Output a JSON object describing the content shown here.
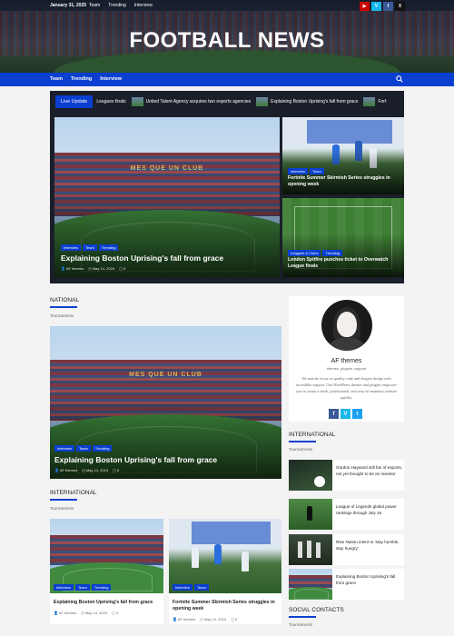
{
  "topbar": {
    "date": "January 31, 2025",
    "links": [
      "Team",
      "Trending",
      "Interview"
    ],
    "social": [
      {
        "name": "youtube-icon",
        "glyph": "▶",
        "color": "#cc0000"
      },
      {
        "name": "vimeo-icon",
        "glyph": "V",
        "color": "#1ab7ea"
      },
      {
        "name": "facebook-icon",
        "glyph": "f",
        "color": "#3b5998"
      },
      {
        "name": "x-icon",
        "glyph": "X",
        "color": "#111111"
      }
    ]
  },
  "site": {
    "title": "FOOTBALL NEWS"
  },
  "nav": {
    "items": [
      "Team",
      "Trending",
      "Interview"
    ]
  },
  "ticker": {
    "label": "Live Update",
    "items": [
      "Leagues finals",
      "United Talent Agency acquires two esports agencies",
      "Explaining Boston Uprising's fall from grace",
      "Fort"
    ]
  },
  "hero": {
    "main": {
      "tags": [
        "Interview",
        "Team",
        "Trending"
      ],
      "title": "Explaining Boston Uprising's fall from grace",
      "author": "AF themes",
      "date": "May 14, 2024",
      "comments": "0"
    },
    "side1": {
      "tags": [
        "Interview",
        "Team"
      ],
      "title": "Fortnite Summer Skirmish Series struggles in opening week"
    },
    "side2": {
      "tags": [
        "Leagues & Clubs",
        "Trending"
      ],
      "title": "London Spitfire punches ticket to Overwatch League finals"
    }
  },
  "stadium_text": "MES QUE UN CLUB",
  "national": {
    "heading": "NATIONAL",
    "sub": "Tournaments",
    "post": {
      "tags": [
        "Interview",
        "Team",
        "Trending"
      ],
      "title": "Explaining Boston Uprising's fall from grace",
      "author": "AF themes",
      "date": "May 14, 2024",
      "comments": "0"
    }
  },
  "international_main": {
    "heading": "INTERNATIONAL",
    "sub": "Tournaments",
    "cards": [
      {
        "tags": [
          "Interview",
          "Team",
          "Trending"
        ],
        "title": "Explaining Boston Uprising's fall from grace",
        "author": "AF themes",
        "date": "May 14, 2024",
        "comments": "0"
      },
      {
        "tags": [
          "Interview",
          "Team"
        ],
        "title": "Fortnite Summer Skirmish Series struggles in opening week",
        "author": "AF themes",
        "date": "May 14, 2024",
        "comments": "0"
      }
    ]
  },
  "profile": {
    "name": "AF themes",
    "role": "themes, plugins, support",
    "bio": "We mainly focus on quality code and elegant design with incredible support. Our WordPress themes and plugins empower you to create a sleek, professional, and easy-to-maintain website quickly.",
    "social": [
      {
        "name": "facebook-icon",
        "glyph": "f",
        "color": "#3b5998"
      },
      {
        "name": "vimeo-icon",
        "glyph": "V",
        "color": "#1ab7ea"
      },
      {
        "name": "twitter-icon",
        "glyph": "t",
        "color": "#1da1f2"
      }
    ]
  },
  "international_side": {
    "heading": "INTERNATIONAL",
    "sub": "Tournaments",
    "items": [
      "Gordon Hayward still fan of esports, not yet thought to be an investor",
      "League of Legends global power rankings through July 16",
      "Rise Nation intent to 'stay humble, stay hungry'",
      "Explaining Boston Uprising's fall from grace"
    ]
  },
  "social_contacts": {
    "heading": "SOCIAL CONTACTS",
    "sub": "Tournaments"
  }
}
